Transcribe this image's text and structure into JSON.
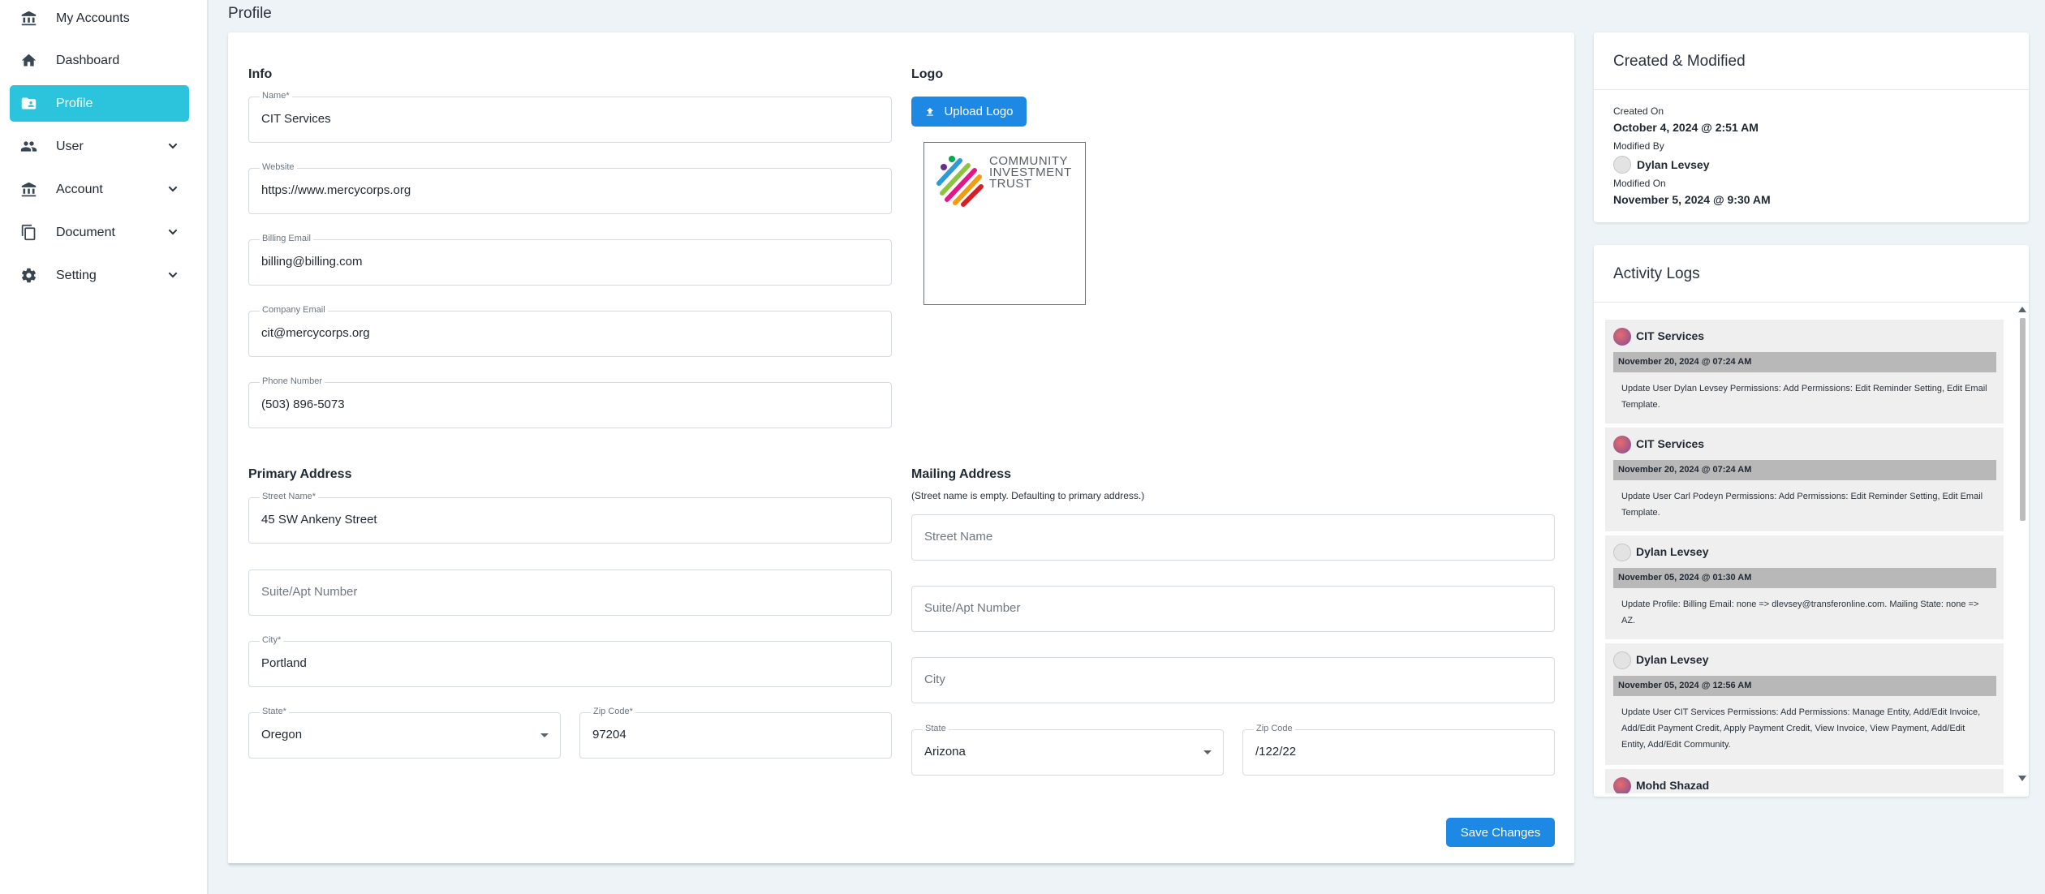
{
  "sidebar": {
    "items": [
      {
        "label": "My Accounts",
        "icon": "bank-icon"
      },
      {
        "label": "Dashboard",
        "icon": "home-icon"
      },
      {
        "label": "Profile",
        "icon": "profile-folder-icon",
        "active": true
      },
      {
        "label": "User",
        "icon": "users-icon",
        "expandable": true
      },
      {
        "label": "Account",
        "icon": "bank-icon",
        "expandable": true
      },
      {
        "label": "Document",
        "icon": "document-icon",
        "expandable": true
      },
      {
        "label": "Setting",
        "icon": "gear-icon",
        "expandable": true
      }
    ]
  },
  "page": {
    "title": "Profile"
  },
  "info": {
    "title": "Info",
    "name": {
      "label": "Name*",
      "value": "CIT Services"
    },
    "website": {
      "label": "Website",
      "value": "https://www.mercycorps.org"
    },
    "billing_email": {
      "label": "Billing Email",
      "value": "billing@billing.com"
    },
    "company_email": {
      "label": "Company Email",
      "value": "cit@mercycorps.org"
    },
    "phone": {
      "label": "Phone Number",
      "value": "(503) 896-5073"
    }
  },
  "logo": {
    "title": "Logo",
    "upload_label": "Upload Logo",
    "logo_lines": [
      "COMMUNITY",
      "INVESTMENT",
      "TRUST"
    ]
  },
  "primary_address": {
    "title": "Primary Address",
    "street": {
      "label": "Street Name*",
      "value": "45 SW Ankeny Street"
    },
    "suite": {
      "placeholder": "Suite/Apt Number"
    },
    "city": {
      "label": "City*",
      "value": "Portland"
    },
    "state": {
      "label": "State*",
      "value": "Oregon"
    },
    "zip": {
      "label": "Zip Code*",
      "value": "97204"
    }
  },
  "mailing_address": {
    "title": "Mailing Address",
    "note": "(Street name is empty. Defaulting to primary address.)",
    "street": {
      "placeholder": "Street Name"
    },
    "suite": {
      "placeholder": "Suite/Apt Number"
    },
    "city": {
      "placeholder": "City"
    },
    "state": {
      "label": "State",
      "value": "Arizona"
    },
    "zip": {
      "label": "Zip Code",
      "value": "/122/22"
    }
  },
  "save_label": "Save Changes",
  "created_modified": {
    "title": "Created & Modified",
    "created_on_label": "Created On",
    "created_on": "October 4, 2024 @ 2:51 AM",
    "modified_by_label": "Modified By",
    "modified_by": "Dylan Levsey",
    "modified_on_label": "Modified On",
    "modified_on": "November 5, 2024 @ 9:30 AM"
  },
  "activity": {
    "title": "Activity Logs",
    "logs": [
      {
        "user": "CIT Services",
        "date": "November 20, 2024 @ 07:24 AM",
        "message": "Update User Dylan Levsey Permissions: Add Permissions: Edit Reminder Setting, Edit Email Template."
      },
      {
        "user": "CIT Services",
        "date": "November 20, 2024 @ 07:24 AM",
        "message": "Update User Carl Podeyn Permissions: Add Permissions: Edit Reminder Setting, Edit Email Template."
      },
      {
        "user": "Dylan Levsey",
        "date": "November 05, 2024 @ 01:30 AM",
        "message": "Update Profile: Billing Email: none => dlevsey@transferonline.com. Mailing State: none => AZ."
      },
      {
        "user": "Dylan Levsey",
        "date": "November 05, 2024 @ 12:56 AM",
        "message": "Update User CIT Services Permissions: Add Permissions: Manage Entity, Add/Edit Invoice, Add/Edit Payment Credit, Apply Payment Credit, View Invoice, View Payment, Add/Edit Entity, Add/Edit Community."
      },
      {
        "user": "Mohd Shazad",
        "date": "",
        "message": ""
      }
    ]
  }
}
